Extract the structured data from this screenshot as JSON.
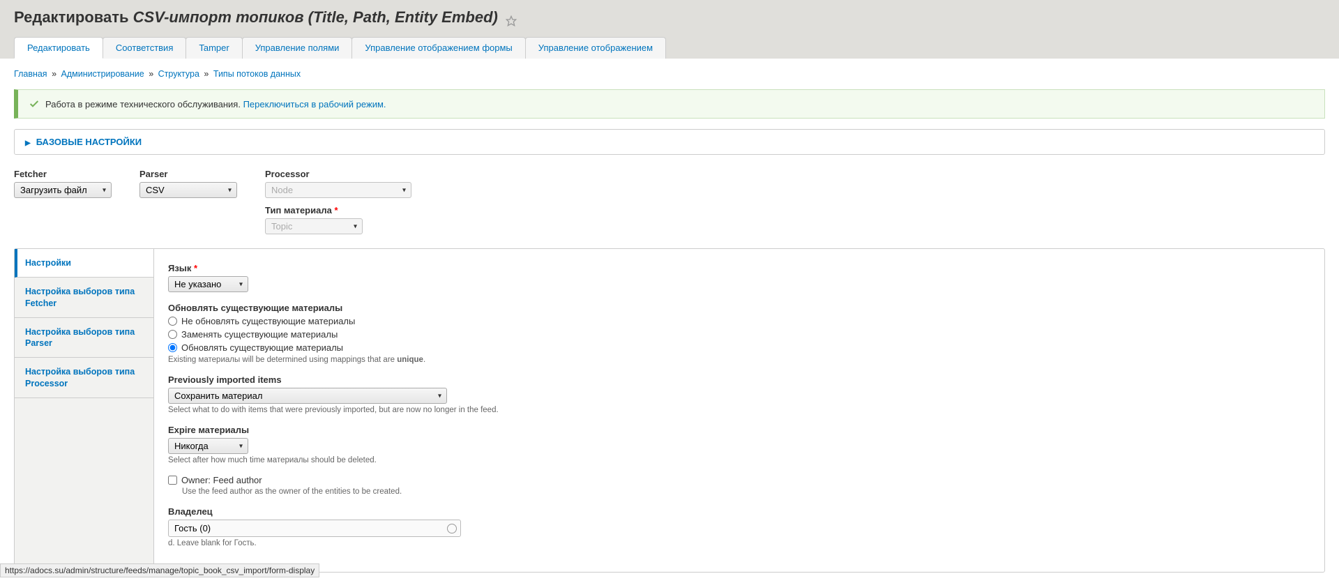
{
  "header": {
    "title_prefix": "Редактировать",
    "title_italic": "CSV-импорт топиков (Title, Path, Entity Embed)"
  },
  "tabs": [
    {
      "label": "Редактировать",
      "active": true
    },
    {
      "label": "Соответствия",
      "active": false
    },
    {
      "label": "Tamper",
      "active": false
    },
    {
      "label": "Управление полями",
      "active": false
    },
    {
      "label": "Управление отображением формы",
      "active": false
    },
    {
      "label": "Управление отображением",
      "active": false
    }
  ],
  "breadcrumb": [
    {
      "label": "Главная"
    },
    {
      "label": "Администрирование"
    },
    {
      "label": "Структура"
    },
    {
      "label": "Типы потоков данных"
    }
  ],
  "status_message": {
    "text": "Работа в режиме технического обслуживания.",
    "link": "Переключиться в рабочий режим."
  },
  "details_summary": "БАЗОВЫЕ НАСТРОЙКИ",
  "selectors": {
    "fetcher": {
      "label": "Fetcher",
      "value": "Загрузить файл"
    },
    "parser": {
      "label": "Parser",
      "value": "CSV"
    },
    "processor": {
      "label": "Processor",
      "value": "Node"
    },
    "content_type": {
      "label": "Тип материала",
      "value": "Topic"
    }
  },
  "vtabs": [
    {
      "label": "Настройки",
      "active": true
    },
    {
      "label": "Настройка выборов типа Fetcher",
      "active": false
    },
    {
      "label": "Настройка выборов типа Parser",
      "active": false
    },
    {
      "label": "Настройка выборов типа Processor",
      "active": false
    }
  ],
  "settings": {
    "language": {
      "label": "Язык",
      "value": "Не указано"
    },
    "update_existing": {
      "label": "Обновлять существующие материалы",
      "options": [
        {
          "label": "Не обновлять существующие материалы",
          "checked": false
        },
        {
          "label": "Заменять существующие материалы",
          "checked": false
        },
        {
          "label": "Обновлять существующие материалы",
          "checked": true
        }
      ],
      "description_pre": "Existing материалы will be determined using mappings that are ",
      "description_bold": "unique",
      "description_post": "."
    },
    "previously_imported": {
      "label": "Previously imported items",
      "value": "Сохранить материал",
      "description": "Select what to do with items that were previously imported, but are now no longer in the feed."
    },
    "expire": {
      "label": "Expire материалы",
      "value": "Никогда",
      "description": "Select after how much time материалы should be deleted."
    },
    "owner_feed_author": {
      "label": "Owner: Feed author",
      "checked": false,
      "description": "Use the feed author as the owner of the entities to be created."
    },
    "owner": {
      "label": "Владелец",
      "value": "Гость (0)",
      "description_suffix": "d. Leave blank for Гость."
    }
  },
  "status_bar_url": "https://adocs.su/admin/structure/feeds/manage/topic_book_csv_import/form-display"
}
